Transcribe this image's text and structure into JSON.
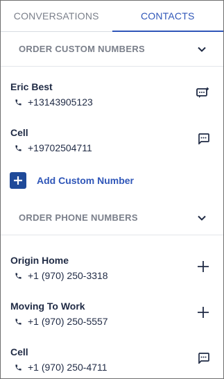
{
  "tabs": [
    {
      "label": "CONVERSATIONS",
      "active": false
    },
    {
      "label": "CONTACTS",
      "active": true
    }
  ],
  "custom_section": {
    "title": "ORDER CUSTOM NUMBERS",
    "contacts": [
      {
        "name": "Eric Best",
        "phone": "+13143905123",
        "action_icon": "message-add-icon"
      },
      {
        "name": "Cell",
        "phone": "+19702504711",
        "action_icon": "message-icon"
      }
    ],
    "add_label": "Add Custom Number"
  },
  "phone_section": {
    "title": "ORDER PHONE NUMBERS",
    "contacts": [
      {
        "name": "Origin Home",
        "phone": "+1 (970) 250-3318",
        "action_icon": "plus-icon"
      },
      {
        "name": "Moving To Work",
        "phone": "+1 (970) 250-5557",
        "action_icon": "plus-icon"
      },
      {
        "name": "Cell",
        "phone": "+1 (970) 250-4711",
        "action_icon": "message-icon"
      }
    ]
  },
  "colors": {
    "accent": "#2f56b8",
    "add_button": "#1f4a99",
    "text": "#1f2a44",
    "muted": "#7a7f8a"
  }
}
